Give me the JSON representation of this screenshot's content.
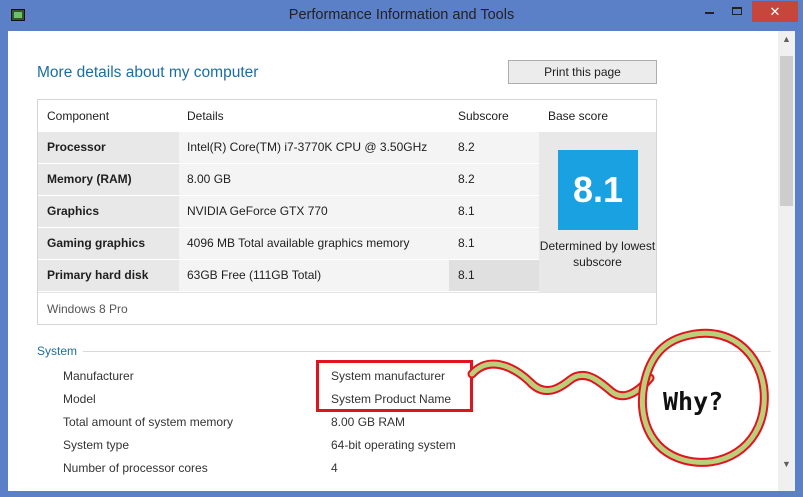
{
  "window": {
    "title": "Performance Information and Tools",
    "close_glyph": "✕"
  },
  "main": {
    "heading": "More details about my computer",
    "print_label": "Print this page"
  },
  "table": {
    "headers": {
      "component": "Component",
      "details": "Details",
      "subscore": "Subscore",
      "base": "Base score"
    },
    "rows": [
      {
        "component": "Processor",
        "details": "Intel(R) Core(TM) i7-3770K CPU @ 3.50GHz",
        "subscore": "8.2"
      },
      {
        "component": "Memory (RAM)",
        "details": "8.00 GB",
        "subscore": "8.2"
      },
      {
        "component": "Graphics",
        "details": "NVIDIA GeForce GTX 770",
        "subscore": "8.1"
      },
      {
        "component": "Gaming graphics",
        "details": "4096 MB Total available graphics memory",
        "subscore": "8.1"
      },
      {
        "component": "Primary hard disk",
        "details": "63GB Free (111GB Total)",
        "subscore": "8.1"
      }
    ],
    "base_score": "8.1",
    "base_caption": "Determined by lowest subscore",
    "os": "Windows 8 Pro",
    "tile_color": "#1aa1e1"
  },
  "system": {
    "heading": "System",
    "rows": [
      {
        "label": "Manufacturer",
        "value": "System manufacturer"
      },
      {
        "label": "Model",
        "value": "System Product Name"
      },
      {
        "label": "Total amount of system memory",
        "value": "8.00 GB RAM"
      },
      {
        "label": "System type",
        "value": "64-bit operating system"
      },
      {
        "label": "Number of processor cores",
        "value": "4"
      }
    ]
  },
  "annotation": {
    "text": "Why?",
    "highlight_color": "#e0141e",
    "squiggle_color": "#b9cf7a"
  }
}
